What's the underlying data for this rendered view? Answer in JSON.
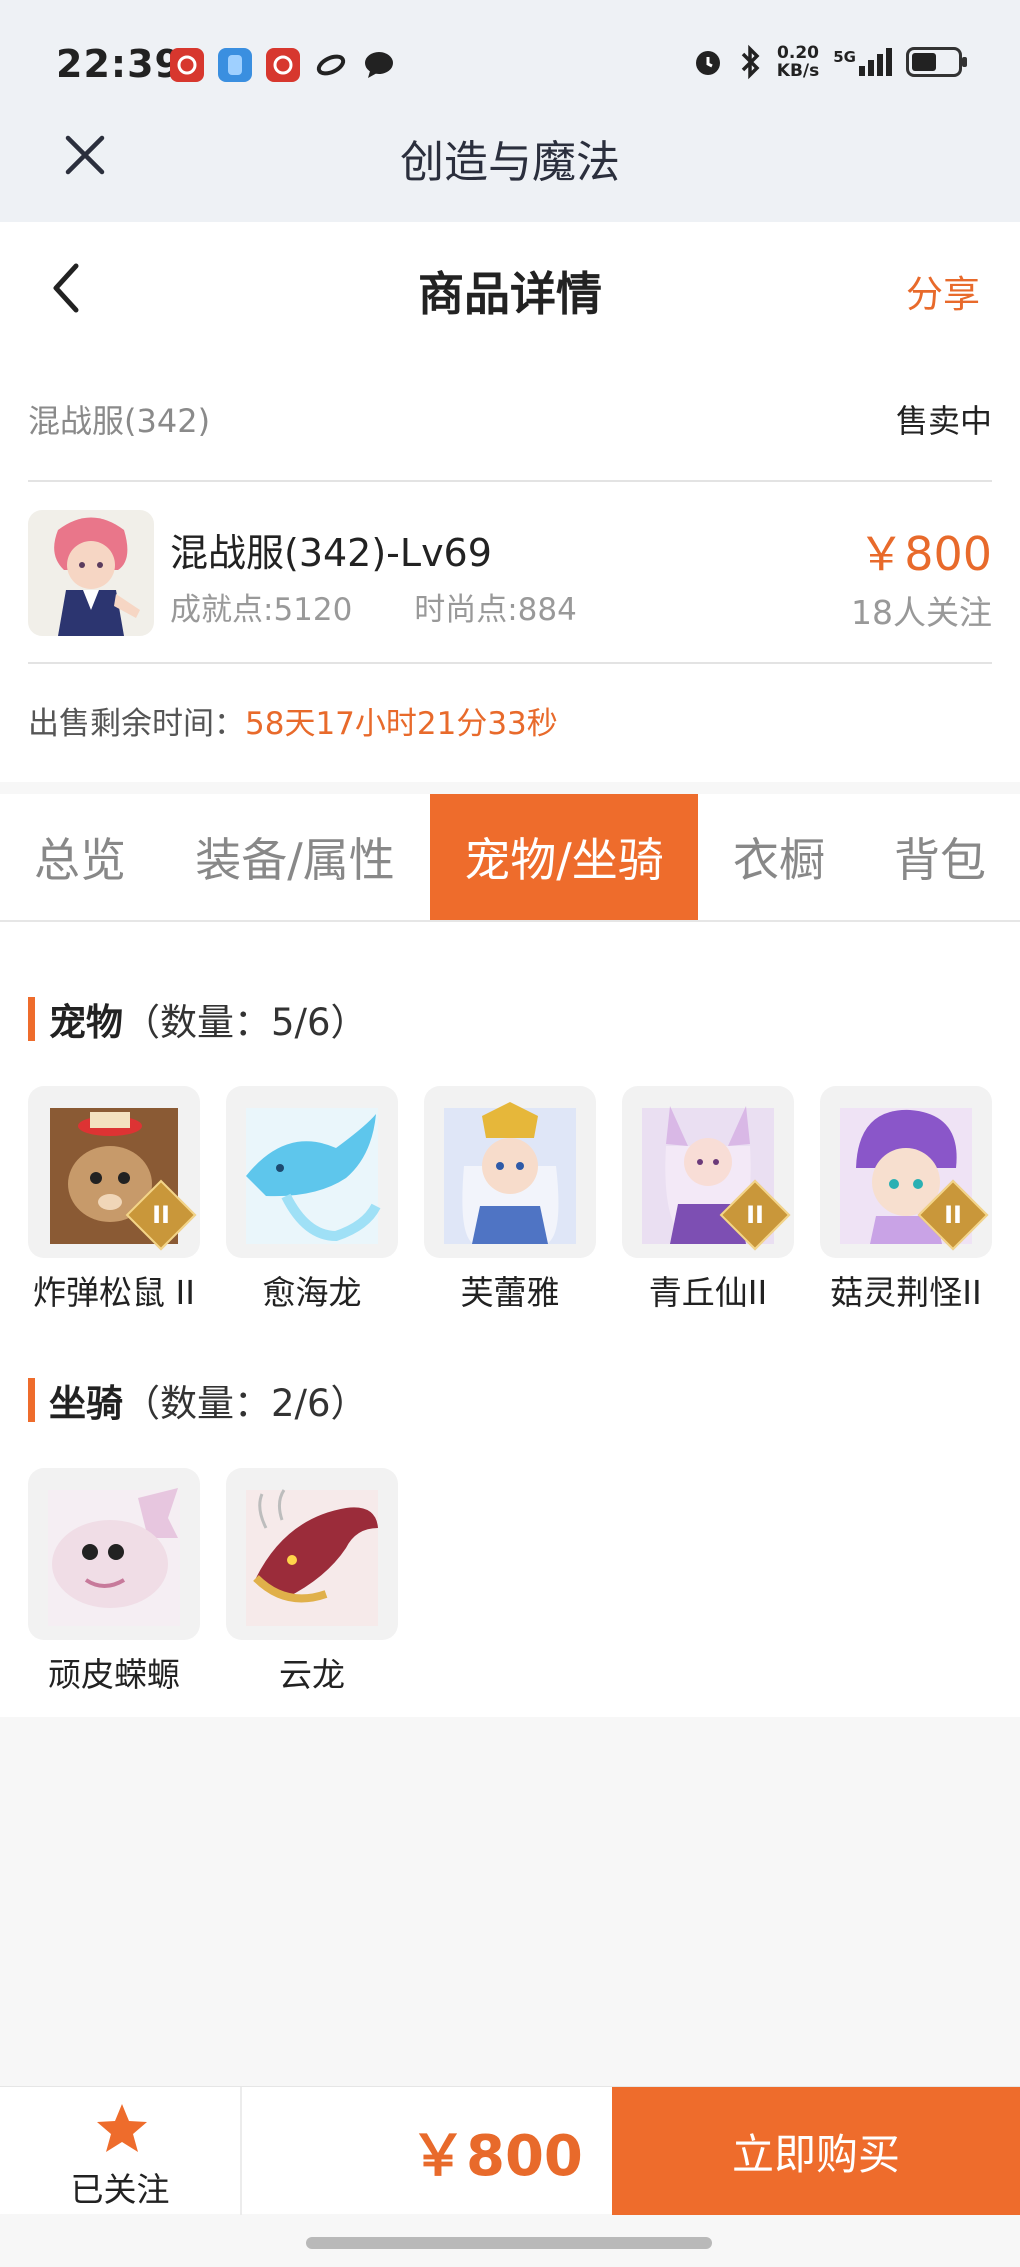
{
  "status_bar": {
    "time": "22:39",
    "net_speed_value": "0.20",
    "net_speed_unit": "KB/s",
    "network": "5G",
    "battery_level": 0.55
  },
  "app": {
    "title": "创造与魔法"
  },
  "header": {
    "title": "商品详情",
    "share_label": "分享"
  },
  "product": {
    "server": "混战服(342)",
    "status": "售卖中",
    "name": "混战服(342)-Lv69",
    "achievement": "成就点:5120",
    "fashion": "时尚点:884",
    "price": "￥800",
    "watchers": "18人关注",
    "remaining_label": "出售剩余时间：",
    "remaining_value": "58天17小时21分33秒"
  },
  "tabs": [
    {
      "label": "总览",
      "active": false
    },
    {
      "label": "装备/属性",
      "active": false
    },
    {
      "label": "宠物/坐骑",
      "active": true
    },
    {
      "label": "衣橱",
      "active": false
    },
    {
      "label": "背包",
      "active": false
    }
  ],
  "pets": {
    "title": "宠物",
    "count": "（数量：5/6）",
    "items": [
      {
        "name": "炸弹松鼠 II",
        "badge": "II"
      },
      {
        "name": "愈海龙",
        "badge": ""
      },
      {
        "name": "芙蕾雅",
        "badge": ""
      },
      {
        "name": "青丘仙II",
        "badge": "II"
      },
      {
        "name": "菇灵荆怪II",
        "badge": "II"
      }
    ]
  },
  "mounts": {
    "title": "坐骑",
    "count": "（数量：2/6）",
    "items": [
      {
        "name": "顽皮蝾螈",
        "badge": ""
      },
      {
        "name": "云龙",
        "badge": ""
      }
    ]
  },
  "bottom": {
    "follow_label": "已关注",
    "price": "￥800",
    "buy_label": "立即购买"
  },
  "colors": {
    "accent": "#ee6c2c",
    "price": "#e86a2b"
  }
}
